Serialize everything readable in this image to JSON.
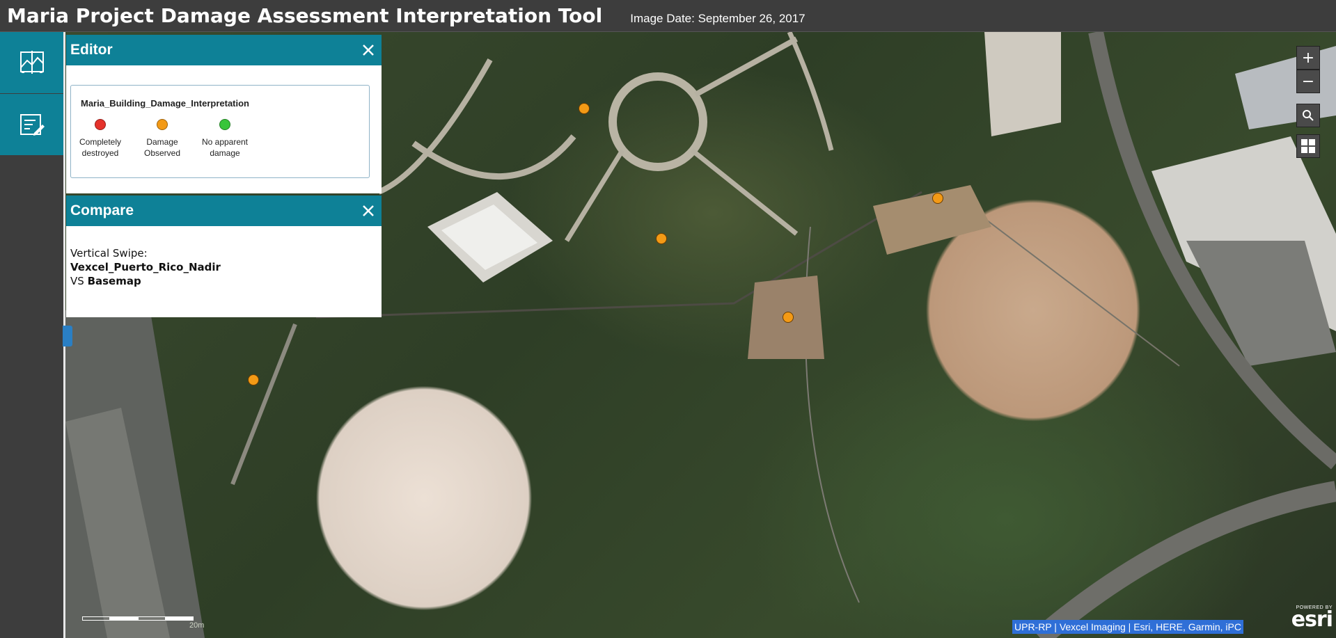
{
  "header": {
    "title": "Maria Project Damage Assessment Interpretation Tool",
    "image_date": "Image Date: September 26, 2017"
  },
  "rail": {
    "items": [
      {
        "icon": "compare-swipe-icon"
      },
      {
        "icon": "editor-form-icon"
      }
    ]
  },
  "editor": {
    "title": "Editor",
    "layer_name": "Maria_Building_Damage_Interpretation",
    "symbols": [
      {
        "line1": "Completely",
        "line2": "destroyed",
        "color": "#e5322b"
      },
      {
        "line1": "Damage",
        "line2": "Observed",
        "color": "#f39a16"
      },
      {
        "line1": "No apparent",
        "line2": "damage",
        "color": "#38c53a"
      }
    ]
  },
  "compare": {
    "title": "Compare",
    "mode": "Vertical Swipe:",
    "layer": "Vexcel_Puerto_Rico_Nadir",
    "vs": "VS",
    "base": "Basemap"
  },
  "map": {
    "zoom_in": "+",
    "zoom_out": "−",
    "scale_label": "20m",
    "attribution": "UPR-RP | Vexcel Imaging | Esri, HERE, Garmin, iPC",
    "logo_powered": "POWERED BY",
    "logo_word": "esri",
    "point_color": "#f39a16",
    "point_count": 5
  }
}
